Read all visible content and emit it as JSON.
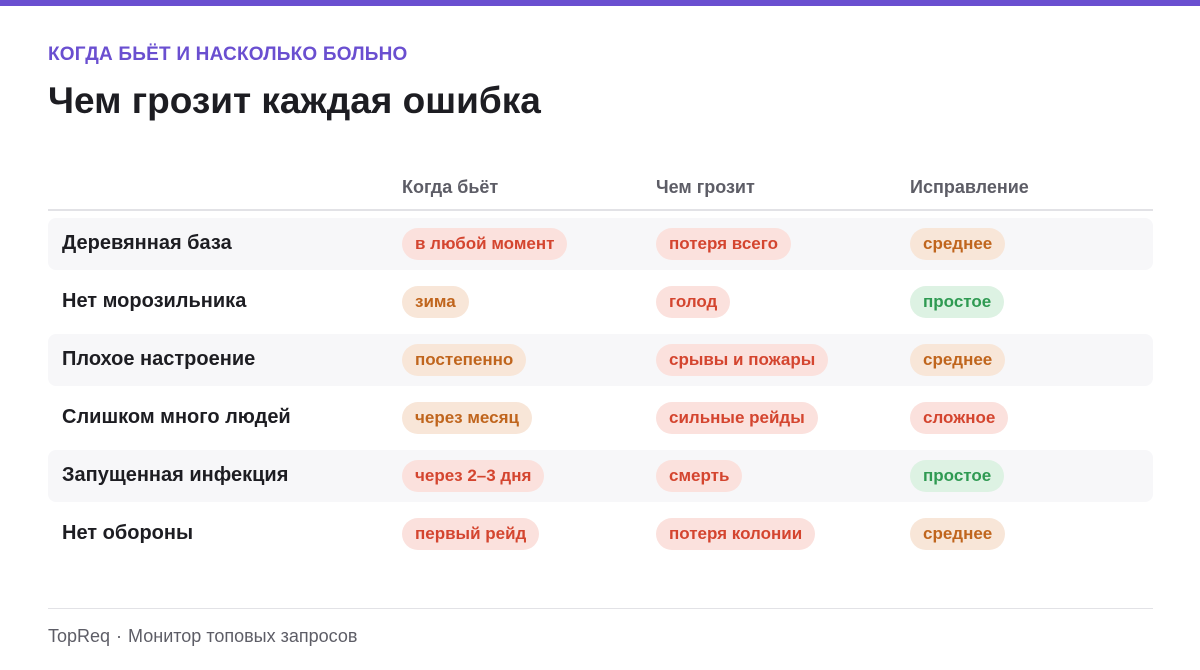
{
  "header": {
    "eyebrow": "КОГДА БЬЁТ И НАСКОЛЬКО БОЛЬНО",
    "title": "Чем грозит каждая ошибка"
  },
  "table": {
    "columns": [
      "Когда бьёт",
      "Чем грозит",
      "Исправление"
    ],
    "rows": [
      {
        "label": "Деревянная база",
        "when": {
          "text": "в любой момент",
          "tone": "red"
        },
        "threat": {
          "text": "потеря всего",
          "tone": "red"
        },
        "fix": {
          "text": "среднее",
          "tone": "orange"
        }
      },
      {
        "label": "Нет морозильника",
        "when": {
          "text": "зима",
          "tone": "orange"
        },
        "threat": {
          "text": "голод",
          "tone": "red"
        },
        "fix": {
          "text": "простое",
          "tone": "green"
        }
      },
      {
        "label": "Плохое настроение",
        "when": {
          "text": "постепенно",
          "tone": "orange"
        },
        "threat": {
          "text": "срывы и пожары",
          "tone": "red"
        },
        "fix": {
          "text": "среднее",
          "tone": "orange"
        }
      },
      {
        "label": "Слишком много людей",
        "when": {
          "text": "через месяц",
          "tone": "orange"
        },
        "threat": {
          "text": "сильные рейды",
          "tone": "red"
        },
        "fix": {
          "text": "сложное",
          "tone": "red"
        }
      },
      {
        "label": "Запущенная инфекция",
        "when": {
          "text": "через 2–3 дня",
          "tone": "red"
        },
        "threat": {
          "text": "смерть",
          "tone": "red"
        },
        "fix": {
          "text": "простое",
          "tone": "green"
        }
      },
      {
        "label": "Нет обороны",
        "when": {
          "text": "первый рейд",
          "tone": "red"
        },
        "threat": {
          "text": "потеря колонии",
          "tone": "red"
        },
        "fix": {
          "text": "среднее",
          "tone": "orange"
        }
      }
    ]
  },
  "footer": {
    "brand": "TopReq",
    "separator": "·",
    "tagline": "Монитор топовых запросов"
  },
  "colors": {
    "accent": "#6a4fd0",
    "red": "#d4452f",
    "orange": "#c0651d",
    "green": "#2f9a52"
  }
}
